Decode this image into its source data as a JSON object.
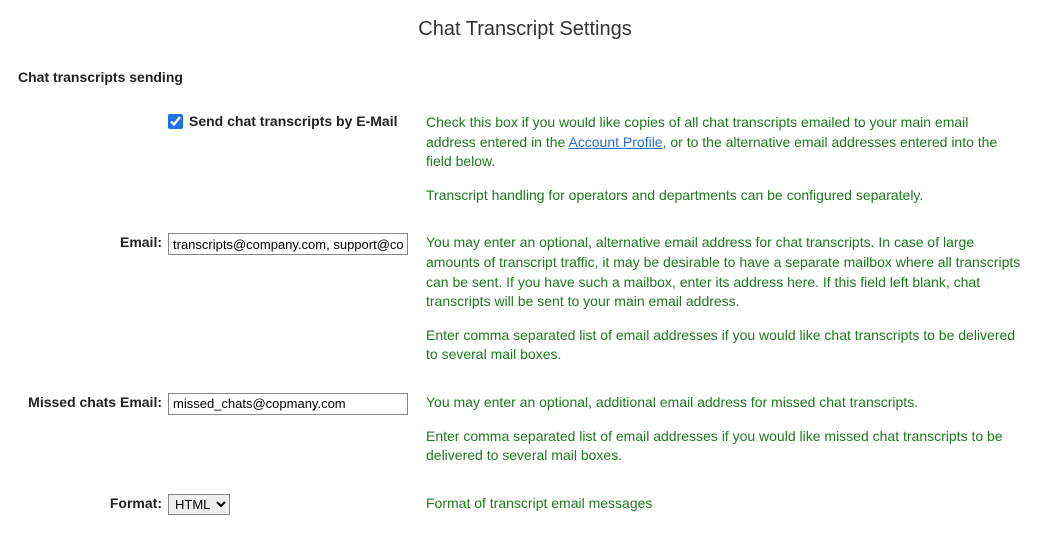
{
  "page_title": "Chat Transcript Settings",
  "section_heading": "Chat transcripts sending",
  "send_checkbox": {
    "label": "Send chat transcripts by E-Mail",
    "checked": true
  },
  "help_send_1a": "Check this box if you would like copies of all chat transcripts emailed to your main email address entered in the ",
  "help_send_link": "Account Profile",
  "help_send_1b": ", or to the alternative email addresses entered into the field below.",
  "help_send_2": "Transcript handling for operators and departments can be configured separately.",
  "email": {
    "label": "Email:",
    "value": "transcripts@company.com, support@corp.com",
    "help1": "You may enter an optional, alternative email address for chat transcripts. In case of large amounts of transcript traffic, it may be desirable to have a separate mailbox where all transcripts can be sent. If you have such a mailbox, enter its address here. If this field left blank, chat transcripts will be sent to your main email address.",
    "help2": "Enter comma separated list of email addresses if you would like chat transcripts to be delivered to several mail boxes."
  },
  "missed": {
    "label": "Missed chats Email:",
    "value": "missed_chats@copmany.com",
    "help1": "You may enter an optional, additional email address for missed chat transcripts.",
    "help2": "Enter comma separated list of email addresses if you would like missed chat transcripts to be delivered to several mail boxes."
  },
  "format": {
    "label": "Format:",
    "selected": "HTML",
    "help": "Format of transcript email messages"
  }
}
